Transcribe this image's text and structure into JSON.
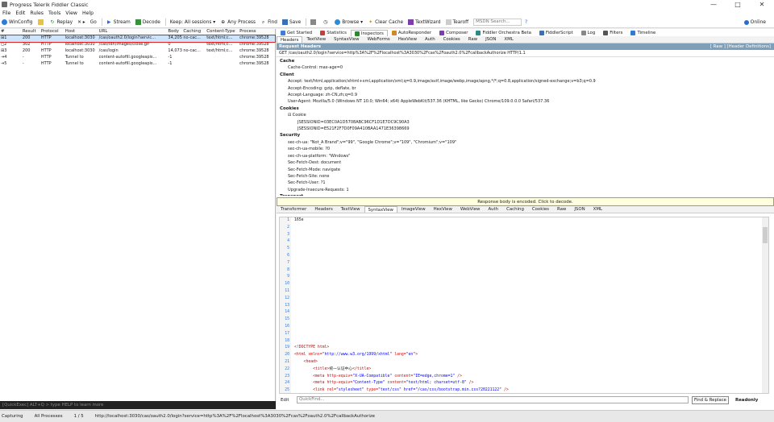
{
  "window": {
    "title": "Progress Telerik Fiddler Classic",
    "min": "—",
    "max": "□",
    "close": "✕"
  },
  "menu": [
    "File",
    "Edit",
    "Rules",
    "Tools",
    "View",
    "Help"
  ],
  "toolbar": {
    "winconfig": "WinConfig",
    "replay": "Replay",
    "remove": "✕ ▸",
    "go": "Go",
    "stream": "Stream",
    "decode": "Decode",
    "keep": "Keep: All sessions ▾",
    "any_process": "Any Process",
    "find": "Find",
    "save": "Save",
    "browse": "Browse ▾",
    "clear_cache": "Clear Cache",
    "textwizard": "TextWizard",
    "tearoff": "Tearoff",
    "msdn_placeholder": "MSDN Search...",
    "online": "Online"
  },
  "sessions": {
    "columns": [
      "#",
      "Result",
      "Protocol",
      "Host",
      "URL",
      "Body",
      "Caching",
      "Content-Type",
      "Process"
    ],
    "rows": [
      [
        "⊞1",
        "200",
        "HTTP",
        "localhost:3030",
        "/cas/oauth2.0/login?servic...",
        "34,205",
        "no-cac...",
        "text/html;c...",
        "chrome:39528"
      ],
      [
        "◻2",
        "302",
        "HTTP",
        "localhost:3030",
        "/cas/tdn/images/close.gif",
        "0",
        "",
        "text/html;c...",
        "chrome:39528"
      ],
      [
        "⊞3",
        "200",
        "HTTP",
        "localhost:3030",
        "/cas/login",
        "14,073",
        "no-cac...",
        "text/html;c...",
        "chrome:39528"
      ],
      [
        "⇥4",
        "-",
        "HTTP",
        "Tunnel to",
        "content-autofill.googleapis...",
        "-1",
        "",
        "",
        "chrome:39528"
      ],
      [
        "⇥5",
        "-",
        "HTTP",
        "Tunnel to",
        "content-autofill.googleapis...",
        "-1",
        "",
        "",
        "chrome:39528"
      ]
    ]
  },
  "quickexec": "[QuickExec] ALT+Q > type HELP to learn more",
  "status": {
    "capturing": "Capturing",
    "processes": "All Processes",
    "count": "1 / 5",
    "url": "http://localhost:3030/cas/oauth2.0/login?service=http%3A%2F%2Flocalhost%3A3030%2Fcas%2Foauth2.0%2FcallbackAuthorize"
  },
  "topTabs": [
    "Get Started",
    "Statistics",
    "Inspectors",
    "AutoResponder",
    "Composer",
    "Fiddler Orchestra Beta",
    "FiddlerScript",
    "Log",
    "Filters",
    "Timeline"
  ],
  "reqTabs": [
    "Headers",
    "TextView",
    "SyntaxView",
    "WebForms",
    "HexView",
    "Auth",
    "Cookies",
    "Raw",
    "JSON",
    "XML"
  ],
  "request": {
    "section_title": "Request Headers",
    "links": "[ Raw ]   [Header Definitions]",
    "line": "GET /cas/oauth2.0/login?service=http%3A%2F%2Flocalhost%3A3030%2Fcas%2Foauth2.0%2FcallbackAuthorize HTTP/1.1",
    "groups": [
      {
        "name": "Cache",
        "items": [
          "Cache-Control: max-age=0"
        ]
      },
      {
        "name": "Client",
        "items": [
          "Accept: text/html,application/xhtml+xml,application/xml;q=0.9,image/avif,image/webp,image/apng,*/*;q=0.8,application/signed-exchange;v=b3;q=0.9",
          "Accept-Encoding: gzip, deflate, br",
          "Accept-Language: zh-CN,zh;q=0.9",
          "User-Agent: Mozilla/5.0 (Windows NT 10.0; Win64; x64) AppleWebKit/537.36 (KHTML, like Gecko) Chrome/109.0.0.0 Safari/537.36"
        ]
      },
      {
        "name": "Cookies",
        "items": [
          "⊟ Cookie"
        ],
        "sub": [
          "JSESSIONID=03EC0A1D5708ABC96CF1D1E7DC9C90A3",
          "JSESSIONID=E521F2F7D0F09A410BAA1471E36398669"
        ]
      },
      {
        "name": "Security",
        "items": [
          "sec-ch-ua: \"Not_A Brand\";v=\"99\", \"Google Chrome\";v=\"109\", \"Chromium\";v=\"109\"",
          "sec-ch-ua-mobile: ?0",
          "sec-ch-ua-platform: \"Windows\"",
          "Sec-Fetch-Dest: document",
          "Sec-Fetch-Mode: navigate",
          "Sec-Fetch-Site: none",
          "Sec-Fetch-User: ?1",
          "Upgrade-Insecure-Requests: 1"
        ]
      },
      {
        "name": "Transport",
        "items": []
      }
    ]
  },
  "response": {
    "notice": "Response body is encoded. Click to decode.",
    "tabs": [
      "Transformer",
      "Headers",
      "TextView",
      "SyntaxView",
      "ImageView",
      "HexView",
      "WebView",
      "Auth",
      "Caching",
      "Cookies",
      "Raw",
      "JSON",
      "XML"
    ],
    "first_line": "165e",
    "code": [
      {
        "tag": "<!DOCTYPE html>"
      },
      {
        "tag": "<html ",
        "attr": "xmlns=",
        "val": "\"http://www.w3.org/1999/xhtml\" ",
        "attr2": "lang=",
        "val2": "\"en\"",
        "end": ">"
      },
      {
        "tag": "    <head>"
      },
      {
        "tag": "        <title>",
        "text": "统一认证中心",
        "end": "</title>"
      },
      {
        "tag": "        <meta ",
        "attr": "http-equiv=",
        "val": "\"X-UA-Compatible\" ",
        "attr2": "content=",
        "val2": "\"IE=edge,chrome=1\"",
        "end": " />"
      },
      {
        "tag": "        <meta ",
        "attr": "http-equiv=",
        "val": "\"Content-Type\" ",
        "attr2": "content=",
        "val2": "\"text/html; charset=utf-8\"",
        "end": " />"
      },
      {
        "tag": "        <link ",
        "attr": "rel=",
        "val": "\"stylesheet\" ",
        "attr2": "type=",
        "val2": "\"text/css\" href=\"/cas/css/bootstrap.min.css?20221122\"",
        "end": " />"
      },
      {
        "tag": "        <link ",
        "attr": "type=",
        "val": "\"text/css\" ",
        "attr2": "rel=",
        "val2": "\"stylesheet\" href=\"/cas/themes/text/login.css?20221122\"",
        "end": " />"
      },
      {
        "tag": "        <link ",
        "attr": "rel=",
        "val": "\"stylesheet\" ",
        "attr2": "type=",
        "val2": "\"text/css\" href=\"/cas/css/bootstrap-style.css?20221122\"",
        "end": " />"
      },
      {
        "tag": "        <link ",
        "attr": "rel=",
        "val": "\"stylesheet\" ",
        "attr2": "type=",
        "val2": "\"text/css\" href=\"/cas/css/font-awesome.min.css?20221122\"",
        "end": " />"
      },
      {
        "tag": "        <link ",
        "attr": "rel=",
        "val": "\"stylesheet\" ",
        "attr2": "type=",
        "val2": "\"text/css\" href=\"/cas/css/icon.css?20221122\"",
        "end": " />"
      },
      {
        "tag": "        <link ",
        "attr": "rel=",
        "val": "\"stylesheet\" ",
        "attr2": "href=",
        "val2": "\"/cas/css/loom.css?20221122\"  type=\"text/css\"",
        "end": " />"
      },
      {
        "tag": "        <link ",
        "attr": "rel=",
        "val": "\"stylesheet\" ",
        "attr2": "type=",
        "val2": "\"text/css\" href=\"/cas/css/jquery.alerts.css?20221122\"",
        "end": " />"
      }
    ],
    "find_placeholder": "QuickFind...",
    "find_label": "Edit",
    "find_button": "Find & Replace",
    "readonly": "Readonly"
  }
}
